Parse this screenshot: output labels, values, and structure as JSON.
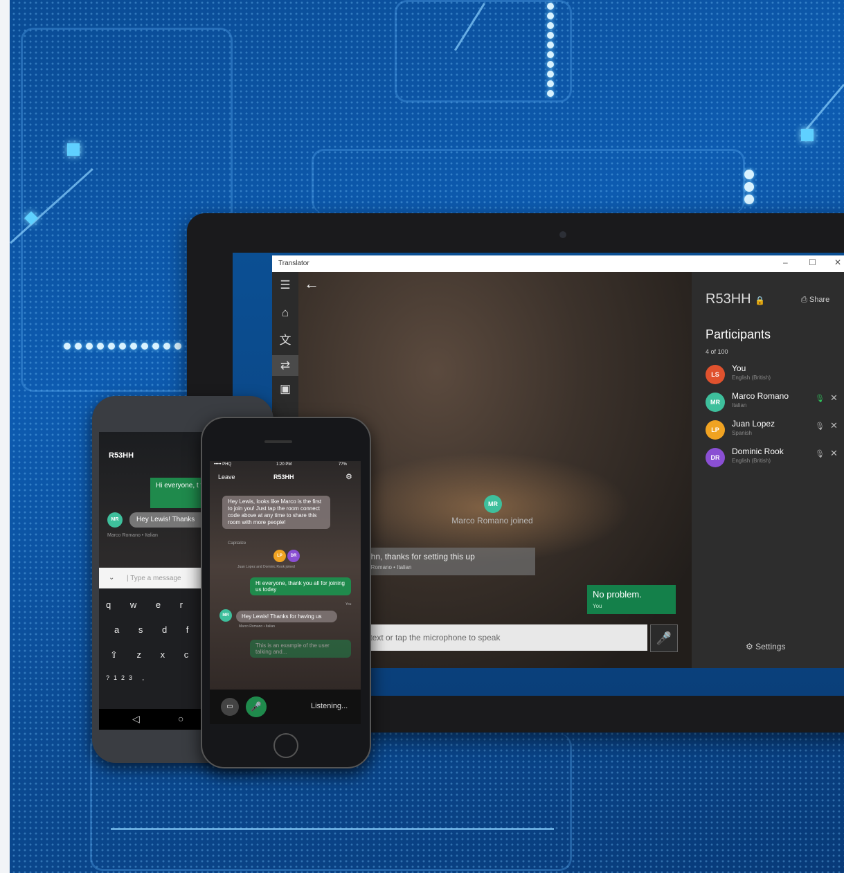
{
  "window": {
    "title": "Translator",
    "minimize": "–",
    "maximize": "☐",
    "close": "✕"
  },
  "nav": {
    "menu_icon": "☰",
    "home_icon": "⌂",
    "translate_icon": "文",
    "conversation_icon": "⇄",
    "phrasebook_icon": "▣",
    "back_icon": "←"
  },
  "conversation": {
    "joined_avatar": "MR",
    "joined_text": "Marco Romano joined",
    "incoming_message": "ohn, thanks for setting this up",
    "incoming_sub": "o Romano • Italian",
    "outgoing_message": "No problem.",
    "outgoing_sub": "You",
    "input_placeholder": "r text or tap the microphone to speak",
    "mic_icon": "🎤"
  },
  "sidebar": {
    "room_code": "R53HH",
    "lock_icon": "🔒",
    "share_label": "Share",
    "participants_title": "Participants",
    "participants_count": "4 of 100",
    "participants": [
      {
        "initials": "LS",
        "name": "You",
        "lang": "English (British)",
        "color": "#e0522e"
      },
      {
        "initials": "MR",
        "name": "Marco Romano",
        "lang": "Italian",
        "color": "#3ebf9c"
      },
      {
        "initials": "LP",
        "name": "Juan Lopez",
        "lang": "Spanish",
        "color": "#f0a322"
      },
      {
        "initials": "DR",
        "name": "Dominic Rook",
        "lang": "English (British)",
        "color": "#8a4fd3"
      }
    ],
    "settings_label": "Settings"
  },
  "android": {
    "room_code": "R53HH",
    "msg1": "Hi everyone, t for joining us t",
    "msg2": "Hey Lewis! Thanks",
    "msg2_sub": "Marco Romano • Italian",
    "avatar": "MR",
    "type_placeholder": "| Type a message",
    "keys_row1": "q w e r t y",
    "keys_row2": "a s d f g h",
    "keys_row3": "⇧ z x c v b",
    "keys_row4": "?123 ,"
  },
  "iphone": {
    "leave": "Leave",
    "room_code": "R53HH",
    "carrier": "••••• PHQ",
    "time": "1:20 PM",
    "battery": "77%",
    "intro": "Hey Lewis, looks like Marco is the first to join you! Just tap the room connect code above at any time to share this room with more people!",
    "intro_sub": "Capitalize",
    "joined_sub": "Juan Lopez and Dominic Rook joined",
    "msg_you": "Hi everyone, thank you all for joining us today",
    "msg_you_sub": "You",
    "msg_marco": "Hey Lewis! Thanks for having us",
    "msg_marco_sub": "Marco Romano • Italian",
    "msg_listen": "This is an example of the user talking and...",
    "listening": "Listening...",
    "avatar_marco": "MR",
    "avatar_lp": "LP",
    "avatar_dr": "DR"
  }
}
